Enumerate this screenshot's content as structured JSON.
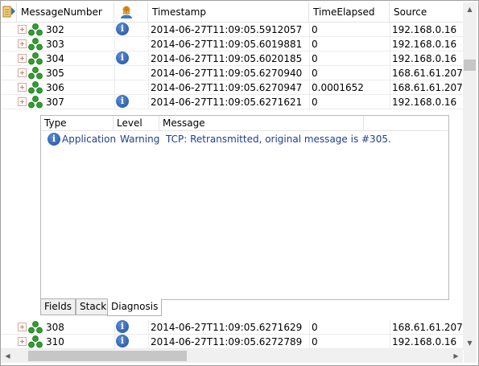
{
  "columns": {
    "message_number": "MessageNumber",
    "timestamp": "Timestamp",
    "time_elapsed": "TimeElapsed",
    "source": "Source"
  },
  "rows_top": [
    {
      "num": "302",
      "info": true,
      "ts": "2014-06-27T11:09:05.5912057",
      "elapsed": "0",
      "src": "192.168.0.16"
    },
    {
      "num": "303",
      "info": false,
      "ts": "2014-06-27T11:09:05.6019881",
      "elapsed": "0",
      "src": "192.168.0.16"
    },
    {
      "num": "304",
      "info": true,
      "ts": "2014-06-27T11:09:05.6020185",
      "elapsed": "0",
      "src": "192.168.0.16"
    },
    {
      "num": "305",
      "info": false,
      "ts": "2014-06-27T11:09:05.6270940",
      "elapsed": "0",
      "src": "168.61.61.207"
    },
    {
      "num": "306",
      "info": false,
      "ts": "2014-06-27T11:09:05.6270947",
      "elapsed": "0.0001652",
      "src": "168.61.61.207"
    },
    {
      "num": "307",
      "info": true,
      "ts": "2014-06-27T11:09:05.6271621",
      "elapsed": "0",
      "src": "192.168.0.16"
    }
  ],
  "rows_bottom": [
    {
      "num": "308",
      "info": true,
      "ts": "2014-06-27T11:09:05.6271629",
      "elapsed": "0",
      "src": "168.61.61.207"
    },
    {
      "num": "310",
      "info": true,
      "ts": "2014-06-27T11:09:05.6272789",
      "elapsed": "0",
      "src": "192.168.0.16"
    }
  ],
  "detail": {
    "columns": {
      "type": "Type",
      "level": "Level",
      "message": "Message"
    },
    "row": {
      "type": "Application",
      "level": "Warning",
      "message": "TCP: Retransmitted, original message is #305."
    },
    "tabs": [
      "Fields",
      "Stack",
      "Diagnosis"
    ],
    "active_tab": "Diagnosis"
  },
  "icons": {
    "corner": "column-chooser-icon",
    "header_warning": "warning-person-icon",
    "node": "network-nodes-icon",
    "info": "info-icon"
  },
  "colors": {
    "info_blue": "#1f4f9e",
    "node_green": "#2da12d",
    "detail_text": "#1f3f8f"
  }
}
